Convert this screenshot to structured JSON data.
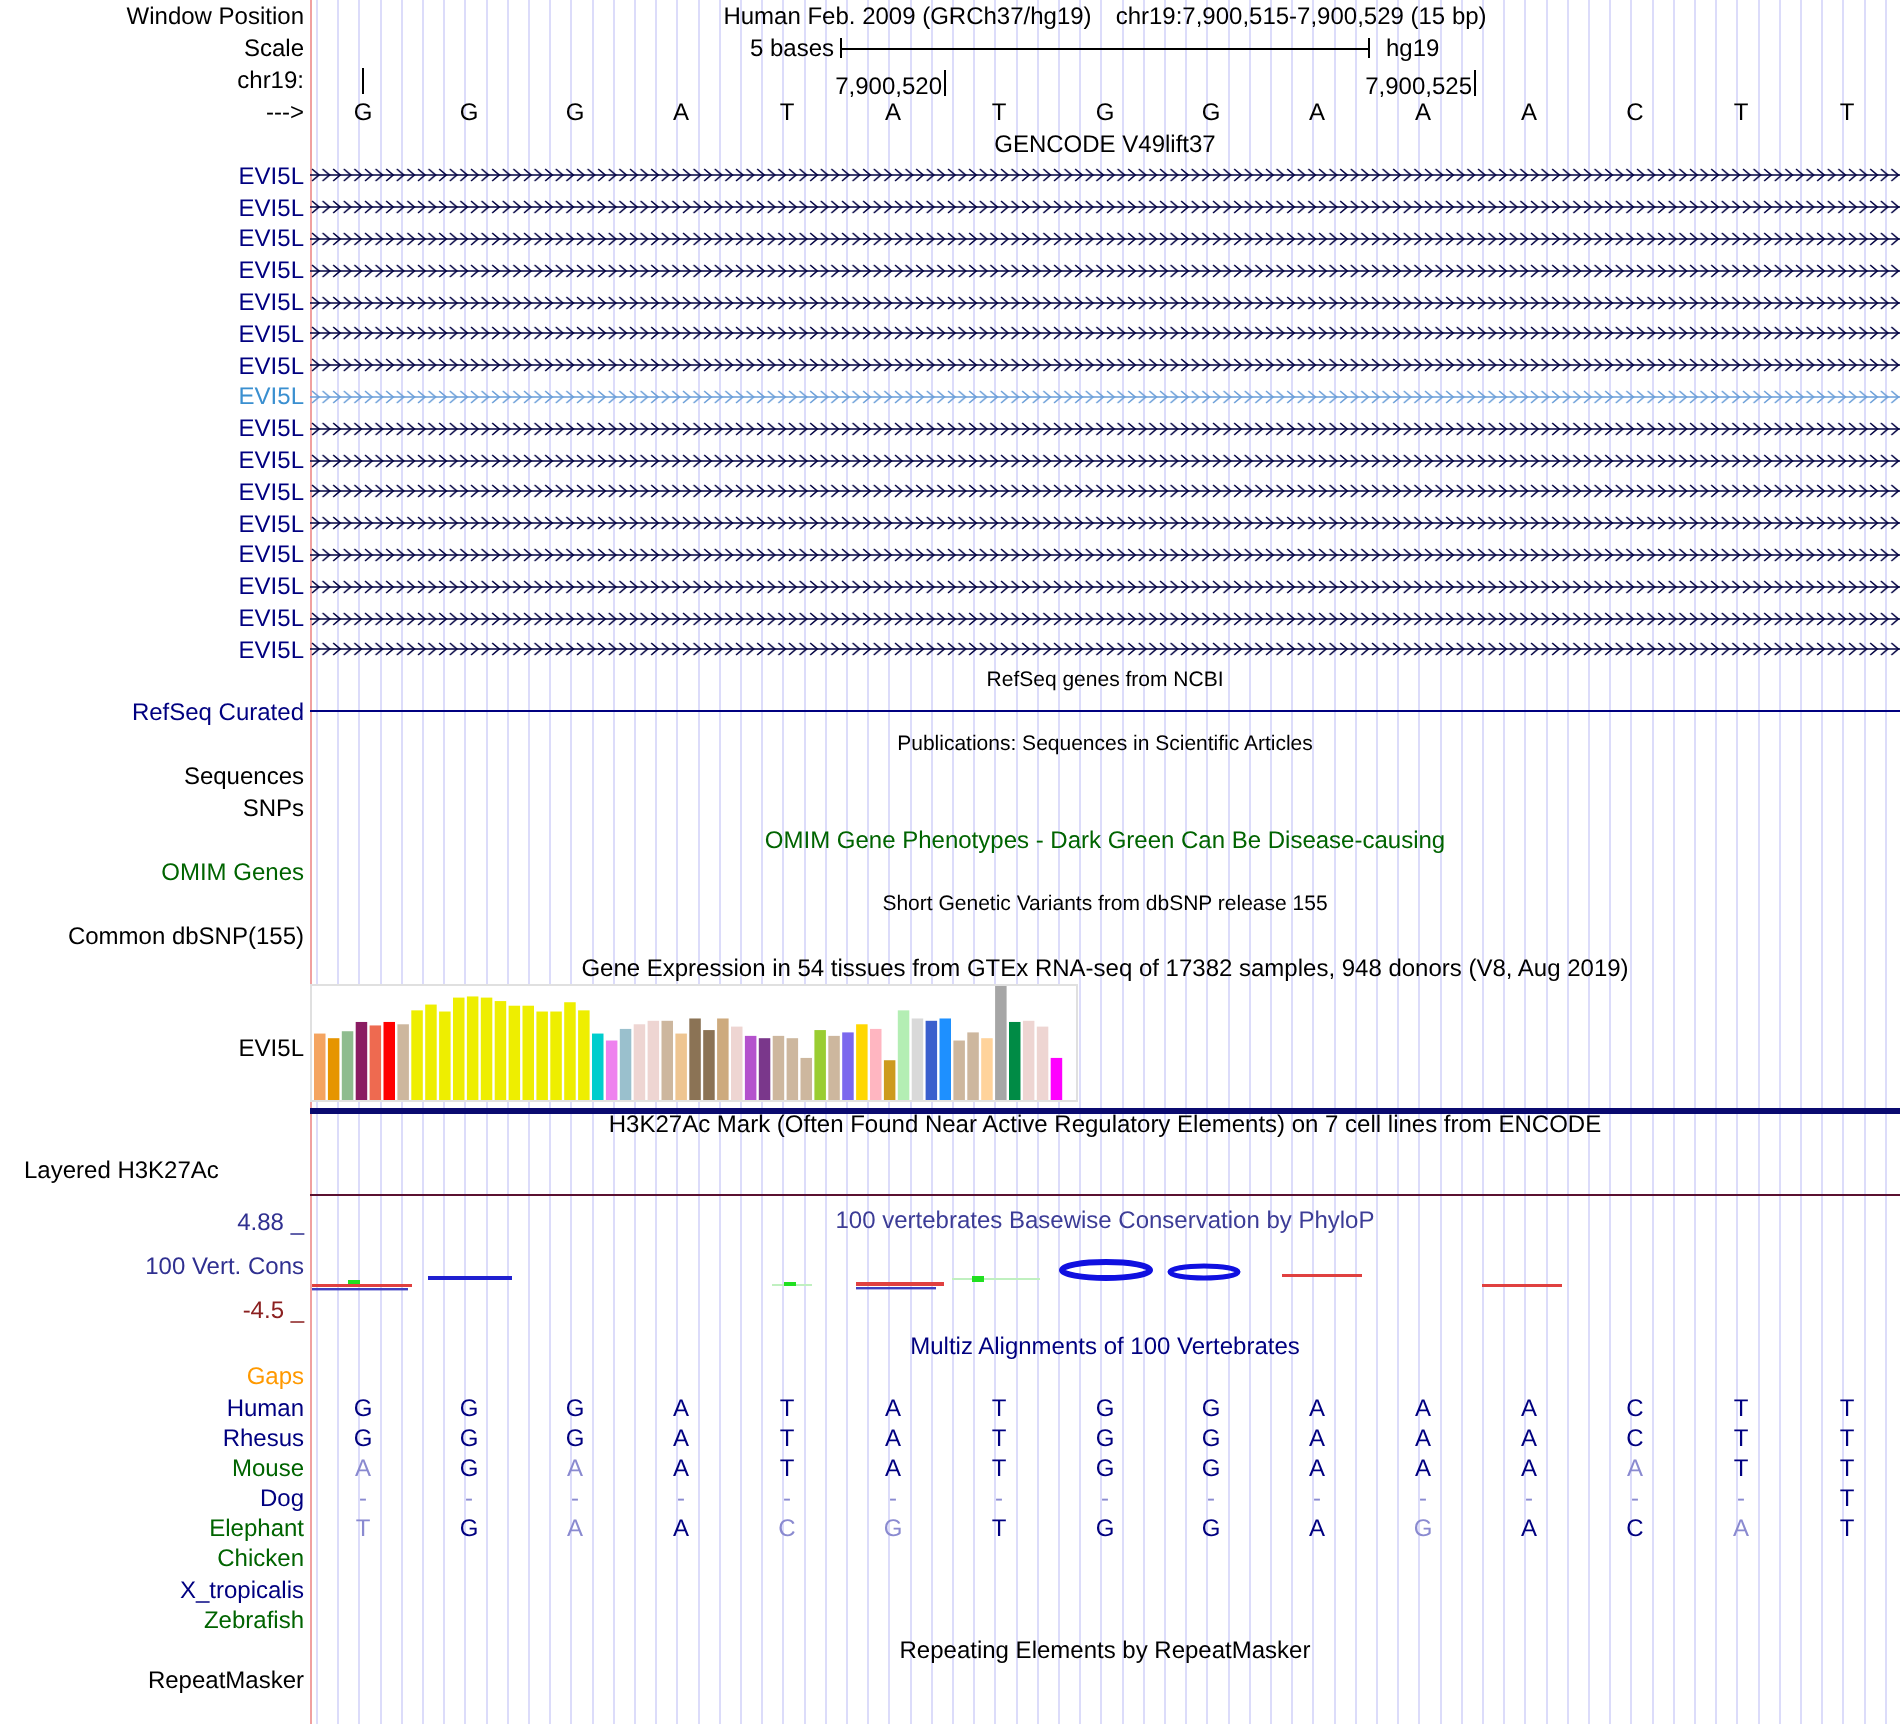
{
  "header": {
    "window_position_label": "Window Position",
    "assembly": "Human Feb. 2009 (GRCh37/hg19)",
    "position": "chr19:7,900,515-7,900,529 (15 bp)",
    "scale_label": "Scale",
    "scale_text": "5 bases",
    "scale_db": "hg19",
    "chrom_label": "chr19:",
    "ticks": [
      "7,900,520",
      "7,900,525"
    ],
    "strand_label": "--->",
    "bases": [
      "G",
      "G",
      "G",
      "A",
      "T",
      "A",
      "T",
      "G",
      "G",
      "A",
      "A",
      "A",
      "C",
      "T",
      "T"
    ]
  },
  "gencode": {
    "title": "GENCODE V49lift37",
    "items": [
      {
        "name": "EVI5L",
        "selected": false
      },
      {
        "name": "EVI5L",
        "selected": false
      },
      {
        "name": "EVI5L",
        "selected": false
      },
      {
        "name": "EVI5L",
        "selected": false
      },
      {
        "name": "EVI5L",
        "selected": false
      },
      {
        "name": "EVI5L",
        "selected": false
      },
      {
        "name": "EVI5L",
        "selected": false
      },
      {
        "name": "EVI5L",
        "selected": true
      },
      {
        "name": "EVI5L",
        "selected": false
      },
      {
        "name": "EVI5L",
        "selected": false
      },
      {
        "name": "EVI5L",
        "selected": false
      },
      {
        "name": "EVI5L",
        "selected": false
      },
      {
        "name": "EVI5L",
        "selected": false
      },
      {
        "name": "EVI5L",
        "selected": false
      },
      {
        "name": "EVI5L",
        "selected": false
      },
      {
        "name": "EVI5L",
        "selected": false
      }
    ]
  },
  "refseq": {
    "title": "RefSeq genes from NCBI",
    "label": "RefSeq Curated"
  },
  "publications": {
    "title": "Publications: Sequences in Scientific Articles",
    "labels": [
      "Sequences",
      "SNPs"
    ]
  },
  "omim": {
    "title": "OMIM Gene Phenotypes - Dark Green Can Be Disease-causing",
    "label": "OMIM Genes"
  },
  "dbsnp": {
    "title": "Short Genetic Variants from dbSNP release 155",
    "label": "Common dbSNP(155)"
  },
  "gtex": {
    "title": "Gene Expression in 54 tissues from GTEx RNA-seq of 17382 samples, 948 donors (V8, Aug 2019)",
    "label": "EVI5L"
  },
  "h3k27ac": {
    "title": "H3K27Ac Mark (Often Found Near Active Regulatory Elements) on 7 cell lines from ENCODE",
    "label": "Layered H3K27Ac"
  },
  "conservation": {
    "title": "100 vertebrates Basewise Conservation by PhyloP",
    "label": "100 Vert. Cons",
    "max": "4.88 _",
    "min": "-4.5 _"
  },
  "multiz": {
    "title": "Multiz Alignments of 100 Vertebrates",
    "species": [
      {
        "name": "Gaps",
        "color": "#ff9900"
      },
      {
        "name": "Human",
        "color": "#000080",
        "bases": [
          "G",
          "G",
          "G",
          "A",
          "T",
          "A",
          "T",
          "G",
          "G",
          "A",
          "A",
          "A",
          "C",
          "T",
          "T"
        ]
      },
      {
        "name": "Rhesus",
        "color": "#000080",
        "bases": [
          "G",
          "G",
          "G",
          "A",
          "T",
          "A",
          "T",
          "G",
          "G",
          "A",
          "A",
          "A",
          "C",
          "T",
          "T"
        ]
      },
      {
        "name": "Mouse",
        "color": "#006400",
        "bases": [
          "A",
          "G",
          "A",
          "A",
          "T",
          "A",
          "T",
          "G",
          "G",
          "A",
          "A",
          "A",
          "A",
          "T",
          "T"
        ]
      },
      {
        "name": "Dog",
        "color": "#000080",
        "bases": [
          "-",
          "-",
          "-",
          "-",
          "-",
          "-",
          "-",
          "-",
          "-",
          "-",
          "-",
          "-",
          "-",
          "-",
          "T"
        ]
      },
      {
        "name": "Elephant",
        "color": "#006400",
        "bases": [
          "T",
          "G",
          "A",
          "A",
          "C",
          "G",
          "T",
          "G",
          "G",
          "A",
          "G",
          "A",
          "C",
          "A",
          "T"
        ]
      },
      {
        "name": "Chicken",
        "color": "#006400"
      },
      {
        "name": "X_tropicalis",
        "color": "#000080"
      },
      {
        "name": "Zebrafish",
        "color": "#006400"
      }
    ]
  },
  "repeatmasker": {
    "title": "Repeating Elements by RepeatMasker",
    "label": "RepeatMasker"
  }
}
